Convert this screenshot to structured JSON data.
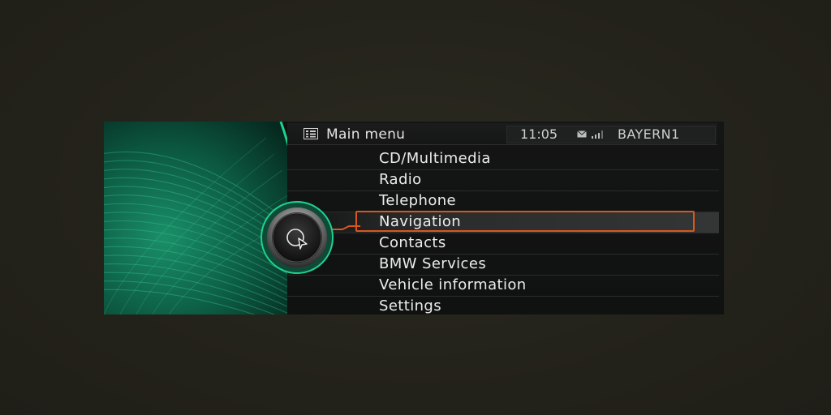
{
  "header": {
    "title_icon": "main-menu-icon",
    "title": "Main menu",
    "time": "11:05",
    "message_icon": "envelope-icon",
    "signal_icon": "signal-strength-icon",
    "station": "BAYERN1"
  },
  "menu": {
    "items": [
      {
        "label": "CD/Multimedia"
      },
      {
        "label": "Radio"
      },
      {
        "label": "Telephone"
      },
      {
        "label": "Navigation",
        "selected": true
      },
      {
        "label": "Contacts"
      },
      {
        "label": "BMW Services"
      },
      {
        "label": "Vehicle information"
      },
      {
        "label": "Settings"
      }
    ]
  },
  "controller": {
    "icon": "navigation-controller-icon"
  },
  "colors": {
    "accent": "#d8571f",
    "green": "#19b77f",
    "background": "#24231b"
  }
}
